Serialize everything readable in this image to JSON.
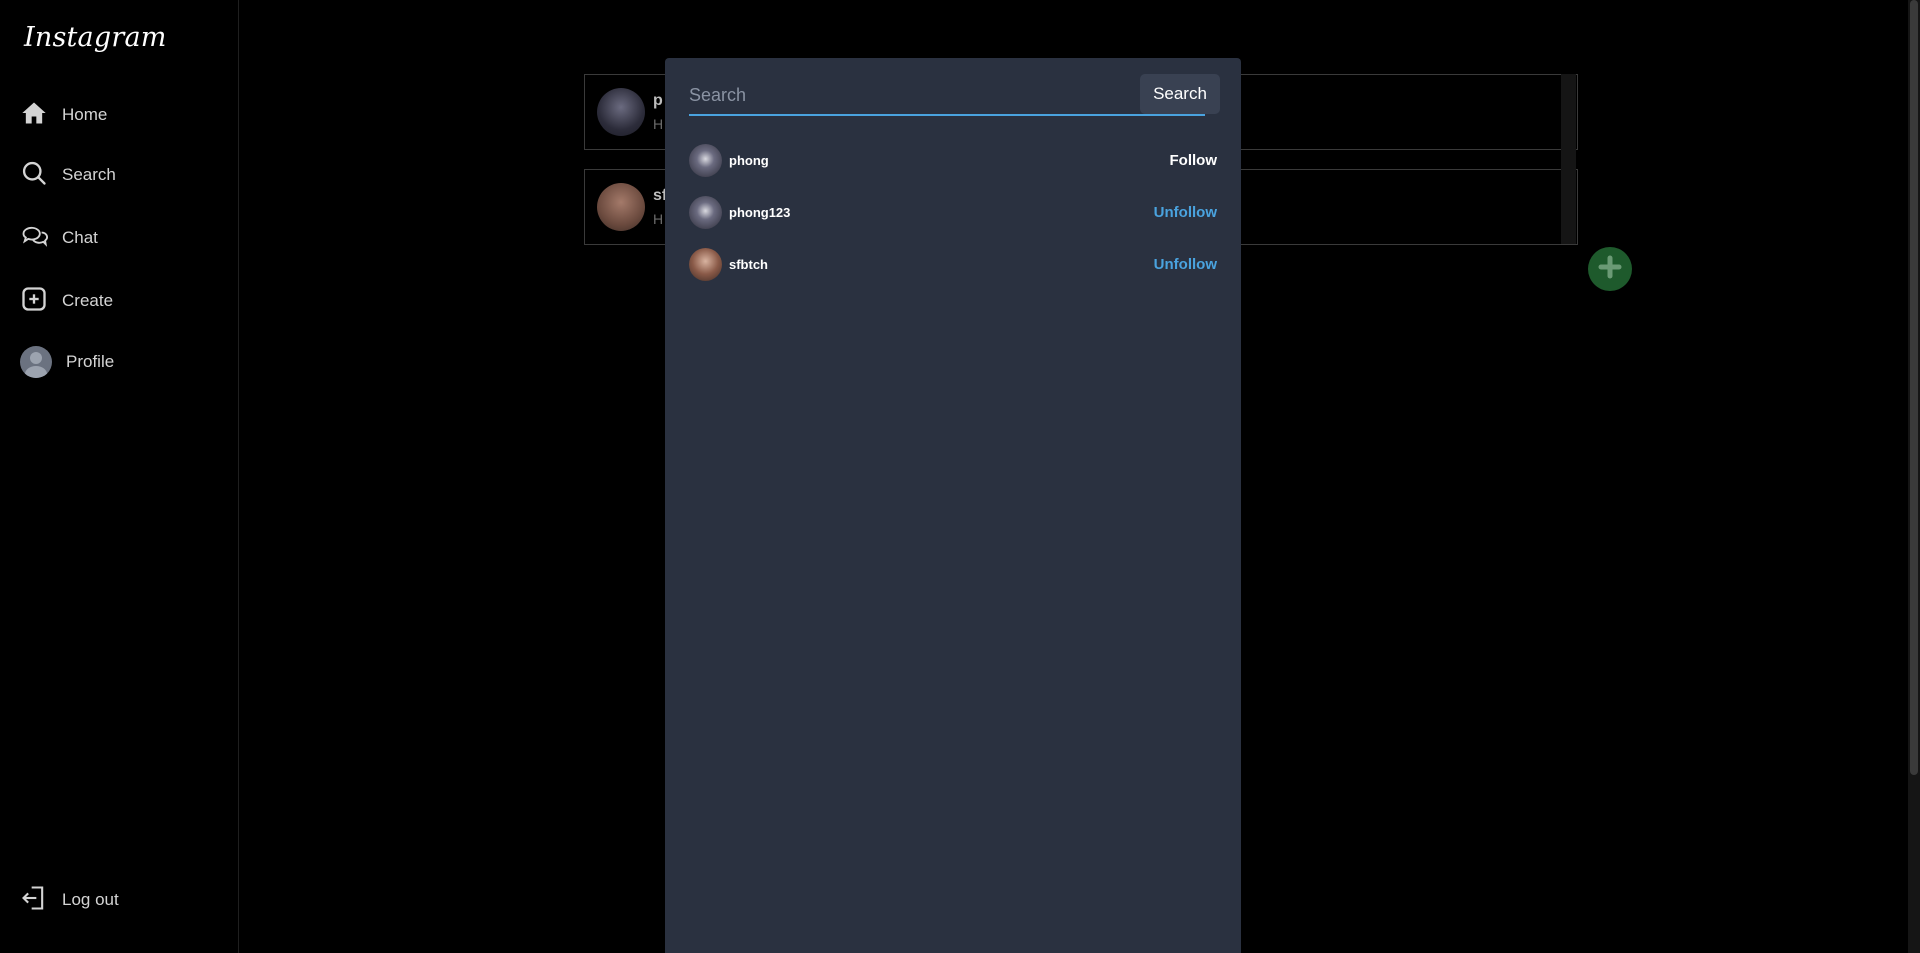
{
  "app": {
    "logo": "Instagram"
  },
  "sidebar": {
    "items": [
      {
        "label": "Home",
        "icon": "home-icon"
      },
      {
        "label": "Search",
        "icon": "search-icon"
      },
      {
        "label": "Chat",
        "icon": "chat-icon"
      },
      {
        "label": "Create",
        "icon": "plus-square-icon"
      },
      {
        "label": "Profile",
        "icon": "avatar"
      }
    ],
    "logout": {
      "label": "Log out",
      "icon": "logout-icon"
    }
  },
  "chats": [
    {
      "name": "p",
      "preview": "H"
    },
    {
      "name": "sf",
      "preview": "H"
    }
  ],
  "search": {
    "placeholder": "Search",
    "value": "",
    "button_label": "Search",
    "results": [
      {
        "username": "phong",
        "action": "Follow"
      },
      {
        "username": "phong123",
        "action": "Unfollow"
      },
      {
        "username": "sfbtch",
        "action": "Unfollow"
      }
    ]
  },
  "colors": {
    "accent": "#4aa3df",
    "panel": "#2a3140",
    "fab": "#1e5a2c"
  }
}
